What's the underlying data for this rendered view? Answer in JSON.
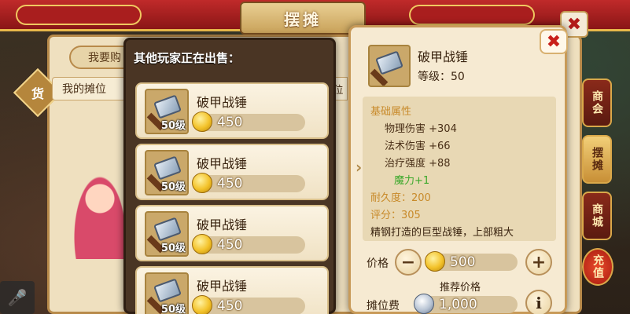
{
  "background": {
    "window_title": "摆摊",
    "tab_label": "我要购",
    "stall_label": "我的摊位",
    "stall_fragment": "位",
    "seal_char": "货",
    "side_nav": [
      {
        "label": "商会",
        "active": false
      },
      {
        "label": "摆摊",
        "active": true
      },
      {
        "label": "商城",
        "active": false
      },
      {
        "label": "充值",
        "active": false
      }
    ],
    "close_icon": "close-icon"
  },
  "listing": {
    "title": "其他玩家正在出售：",
    "items": [
      {
        "name": "破甲战锤",
        "level": "50级",
        "price": "450"
      },
      {
        "name": "破甲战锤",
        "level": "50级",
        "price": "450"
      },
      {
        "name": "破甲战锤",
        "level": "50级",
        "price": "450"
      },
      {
        "name": "破甲战锤",
        "level": "50级",
        "price": "450"
      }
    ]
  },
  "detail": {
    "name": "破甲战锤",
    "level_text": "等级：50",
    "attr_header": "基础属性",
    "stats": [
      "物理伤害 +304",
      "法术伤害 +66",
      "治疗强度 +88"
    ],
    "magic": "魔力+1",
    "durability": "耐久度：200",
    "score": "评分：305",
    "description": "精钢打造的巨型战锤，上部粗大",
    "price_label": "价格",
    "price_value": "500",
    "recommend_label": "推荐价格",
    "fee_label": "摊位费",
    "fee_value": "1,000",
    "minus_symbol": "−",
    "plus_symbol": "+",
    "info_symbol": "i",
    "close_symbol": "✖"
  }
}
